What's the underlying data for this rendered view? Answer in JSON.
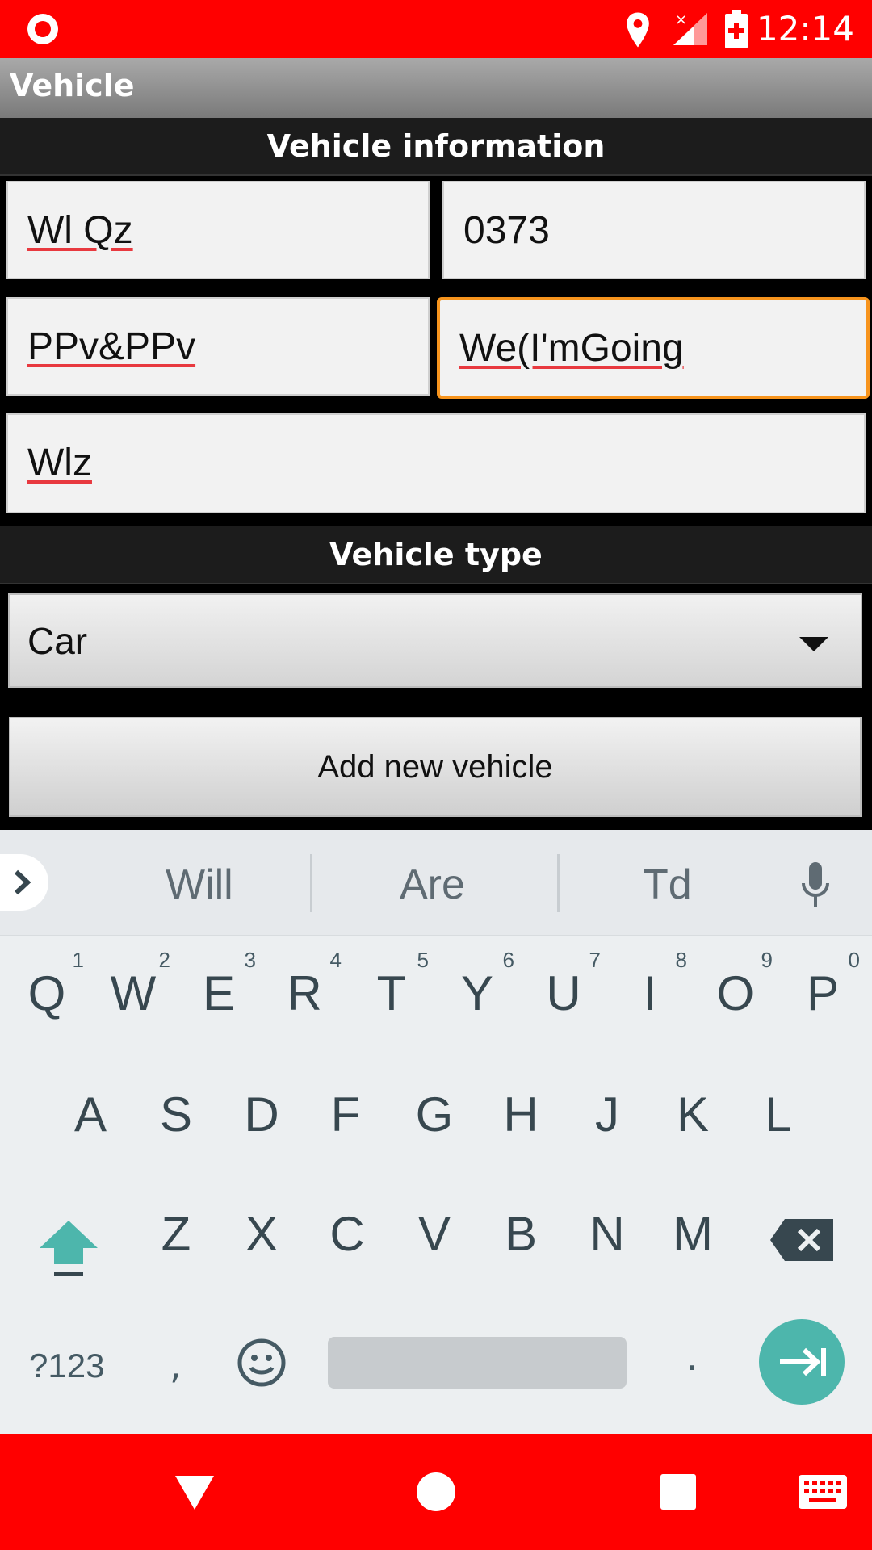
{
  "status_bar": {
    "time": "12:14"
  },
  "title_bar": {
    "title": "Vehicle"
  },
  "vehicle_info": {
    "header": "Vehicle information",
    "fields": [
      "Wl Qz",
      "0373",
      "PPv&PPv",
      "We(I'mGoing",
      "Wlz"
    ]
  },
  "vehicle_type": {
    "header": "Vehicle type",
    "selected": "Car"
  },
  "add_button": {
    "label": "Add new vehicle"
  },
  "keyboard": {
    "suggestions": [
      "Will",
      "Are",
      "Td"
    ],
    "row1": [
      {
        "k": "Q",
        "n": "1"
      },
      {
        "k": "W",
        "n": "2"
      },
      {
        "k": "E",
        "n": "3"
      },
      {
        "k": "R",
        "n": "4"
      },
      {
        "k": "T",
        "n": "5"
      },
      {
        "k": "Y",
        "n": "6"
      },
      {
        "k": "U",
        "n": "7"
      },
      {
        "k": "I",
        "n": "8"
      },
      {
        "k": "O",
        "n": "9"
      },
      {
        "k": "P",
        "n": "0"
      }
    ],
    "row2": [
      "A",
      "S",
      "D",
      "F",
      "G",
      "H",
      "J",
      "K",
      "L"
    ],
    "row3": [
      "Z",
      "X",
      "C",
      "V",
      "B",
      "N",
      "M"
    ],
    "symbols_label": "?123",
    "comma": ",",
    "period": "."
  },
  "colors": {
    "accent": "#ff0000",
    "focus": "#f7941d",
    "enter": "#4db6ac"
  },
  "icons": [
    "record-icon",
    "location-icon",
    "signal-icon",
    "battery-icon",
    "chevron-right-icon",
    "mic-icon",
    "shift-icon",
    "backspace-icon",
    "emoji-icon",
    "enter-icon",
    "back-icon",
    "home-icon",
    "recents-icon",
    "keyboard-icon"
  ]
}
